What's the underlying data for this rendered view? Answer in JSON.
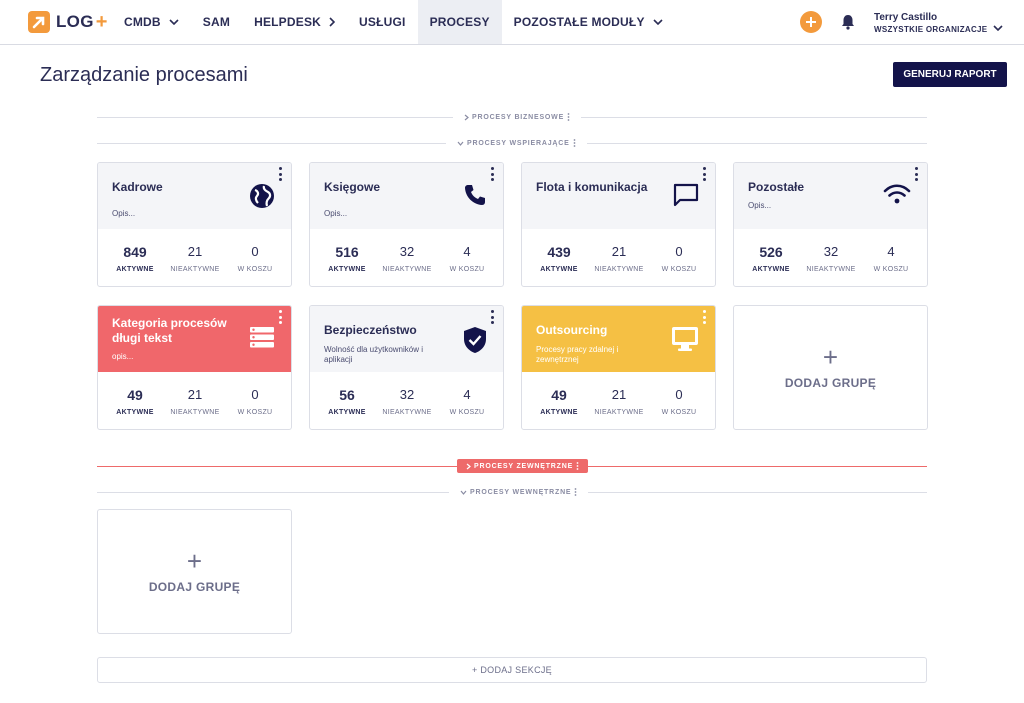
{
  "app": {
    "logo_text": "LOG",
    "logo_plus": "+",
    "nav": [
      {
        "label": "CMDB",
        "chevron": "down"
      },
      {
        "label": "SAM",
        "chevron": ""
      },
      {
        "label": "HELPDESK",
        "chevron": "right"
      },
      {
        "label": "USŁUGI",
        "chevron": ""
      },
      {
        "label": "PROCESY",
        "chevron": "",
        "active": true
      },
      {
        "label": "POZOSTAŁE MODUŁY",
        "chevron": "down"
      }
    ],
    "user": {
      "name": "Terry Castillo",
      "org": "WSZYSTKIE ORGANIZACJE"
    }
  },
  "page": {
    "title": "Zarządzanie procesami",
    "report_button": "GENERUJ RAPORT"
  },
  "sections": {
    "business": "PROCESY BIZNESOWE",
    "supporting": "PROCESY WSPIERAJĄCE",
    "external": "PROCESY ZEWNĘTRZNE",
    "internal": "PROCESY WEWNĘTRZNE"
  },
  "stat_labels": {
    "active": "AKTYWNE",
    "inactive": "NIEAKTYWNE",
    "trash": "W KOSZU"
  },
  "cards": [
    {
      "title": "Kadrowe",
      "desc": "Opis...",
      "icon": "globe-icon",
      "active": "849",
      "inactive": "21",
      "trash": "0",
      "color": "#f4f5f8"
    },
    {
      "title": "Księgowe",
      "desc": "Opis...",
      "icon": "phone-icon",
      "active": "516",
      "inactive": "32",
      "trash": "4",
      "color": "#f4f5f8"
    },
    {
      "title": "Flota i komunikacja",
      "desc": "",
      "icon": "chat-icon",
      "active": "439",
      "inactive": "21",
      "trash": "0",
      "color": "#f4f5f8"
    },
    {
      "title": "Pozostałe",
      "desc": "Opis...",
      "icon": "wifi-icon",
      "active": "526",
      "inactive": "32",
      "trash": "4",
      "color": "#f4f5f8"
    },
    {
      "title": "Kategoria procesów długi tekst",
      "desc": "opis...",
      "icon": "list-icon",
      "active": "49",
      "inactive": "21",
      "trash": "0",
      "color": "#f0676b"
    },
    {
      "title": "Bezpieczeństwo",
      "desc": "Wolność dla użytkowników i aplikacji",
      "icon": "shield-check-icon",
      "active": "56",
      "inactive": "32",
      "trash": "4",
      "color": "#f4f5f8"
    },
    {
      "title": "Outsourcing",
      "desc": "Procesy pracy zdalnej i zewnętrznej",
      "icon": "monitor-icon",
      "active": "49",
      "inactive": "21",
      "trash": "0",
      "color": "#f5c044"
    }
  ],
  "add_group_label": "DODAJ GRUPĘ",
  "add_group_plus": "+",
  "add_section_label": "+ DODAJ SEKCJĘ"
}
